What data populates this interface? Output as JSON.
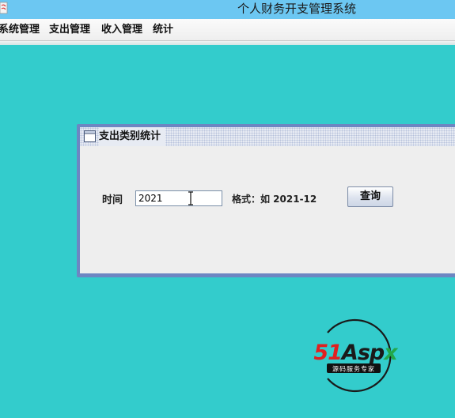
{
  "window": {
    "title": "个人财务开支管理系统"
  },
  "menu": {
    "items": [
      {
        "label": "系统管理"
      },
      {
        "label": "支出管理"
      },
      {
        "label": "收入管理"
      },
      {
        "label": "统计"
      }
    ]
  },
  "dialog": {
    "title": "支出类别统计",
    "time_label": "时间",
    "time_value": "2021",
    "format_hint": "格式：如 2021-12",
    "query_button": "查询"
  },
  "logo": {
    "brand": "51Aspx",
    "tagline": "源码服务专家"
  },
  "colors": {
    "desktop": "#33cccc",
    "titlebar": "#6cc7f2",
    "frame": "#6d86c2",
    "logo_red": "#e02020",
    "logo_green": "#22a84a"
  }
}
